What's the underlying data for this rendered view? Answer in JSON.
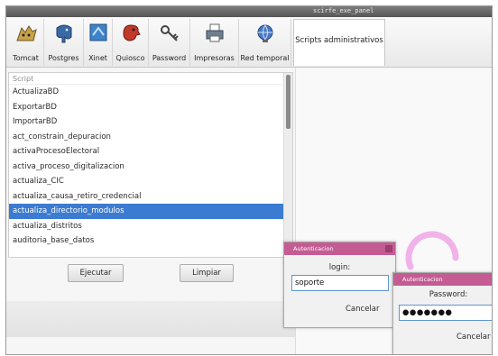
{
  "window": {
    "title": "scirfe_exe_panel"
  },
  "toolbar": {
    "items": [
      {
        "label": "Tomcat",
        "icon": "cat-icon"
      },
      {
        "label": "Postgres",
        "icon": "elephant-icon"
      },
      {
        "label": "Xinet",
        "icon": "network-icon"
      },
      {
        "label": "Quiosco",
        "icon": "kiosk-icon"
      },
      {
        "label": "Password",
        "icon": "key-icon"
      },
      {
        "label": "Impresoras",
        "icon": "printer-icon"
      },
      {
        "label": "Red temporal",
        "icon": "globe-network-icon"
      }
    ],
    "active_tab": "Scripts administrativos"
  },
  "list": {
    "header": "Script",
    "items": [
      "ActualizaBD",
      "ExportarBD",
      "ImportarBD",
      "act_constrain_depuracion",
      "activaProcesoElectoral",
      "activa_proceso_digitalizacion",
      "actualiza_CIC",
      "actualiza_causa_retiro_credencial",
      "actualiza_directorio_modulos",
      "actualiza_distritos",
      "auditoria_base_datos"
    ],
    "selected_index": 8
  },
  "buttons": {
    "execute": "Ejecutar",
    "clear": "Limpiar"
  },
  "login_dialog": {
    "title": "Autenticacion",
    "label": "login:",
    "value": "soporte",
    "cancel": "Cancelar"
  },
  "password_dialog": {
    "title": "Autenticacion",
    "label": "Password:",
    "value": "●●●●●●●",
    "cancel": "Cancelar"
  },
  "colors": {
    "selection": "#3b7bd1",
    "dialog_title": "#c45c93",
    "accent_ring": "#f0a6e8"
  }
}
